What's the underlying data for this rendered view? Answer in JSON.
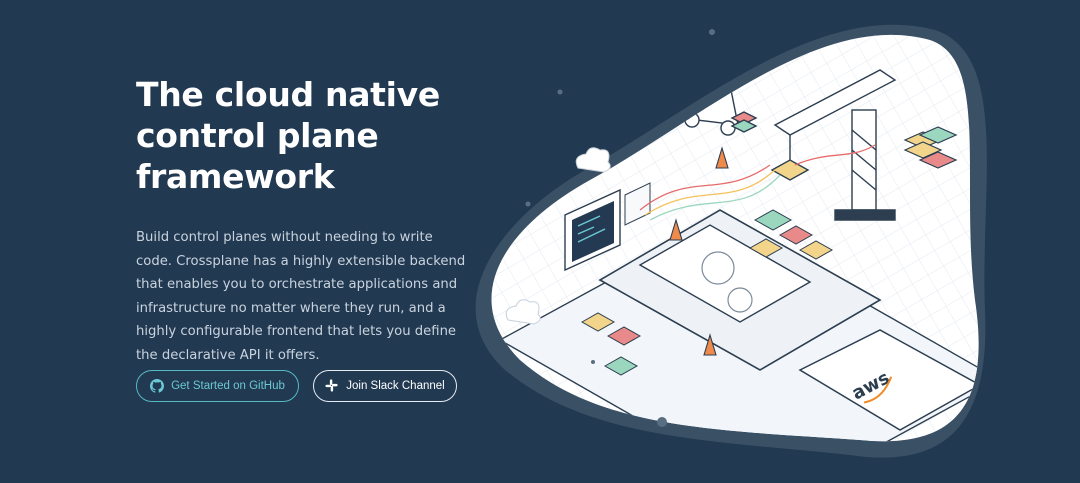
{
  "hero": {
    "title": "The cloud native\ncontrol plane\nframework",
    "description": "Build control planes without needing to write code. Crossplane has a highly extensible backend that enables you to orchestrate applications and infrastructure no matter where they run, and a highly configurable frontend that lets you define the declarative API it offers.",
    "buttons": {
      "github_label": "Get Started on GitHub",
      "slack_label": "Join Slack Channel"
    }
  },
  "illustration": {
    "cloud_logo_text": "aws"
  },
  "icons": {
    "github": "github-icon",
    "slack": "slack-icon"
  },
  "colors": {
    "background": "#213951",
    "accent": "#57b9c4",
    "illustration_bg": "#ffffff"
  }
}
